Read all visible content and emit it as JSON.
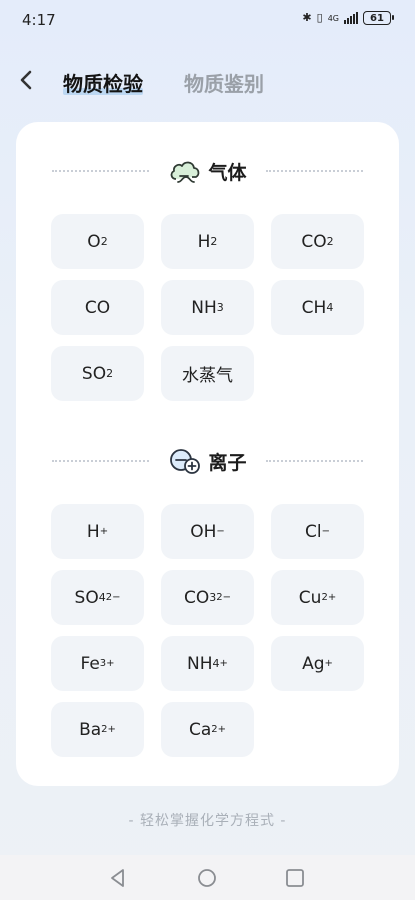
{
  "status": {
    "time": "4:17",
    "network": "4G",
    "battery": "61"
  },
  "header": {
    "back_icon": "chevron-left-icon",
    "tabs": [
      {
        "label": "物质检验",
        "active": true
      },
      {
        "label": "物质鉴别",
        "active": false
      }
    ]
  },
  "sections": [
    {
      "title": "气体",
      "icon": "cloud-icon",
      "items": [
        {
          "base": "O",
          "sub": "2",
          "sup": ""
        },
        {
          "base": "H",
          "sub": "2",
          "sup": ""
        },
        {
          "base": "CO",
          "sub": "2",
          "sup": ""
        },
        {
          "base": "CO",
          "sub": "",
          "sup": ""
        },
        {
          "base": "NH",
          "sub": "3",
          "sup": ""
        },
        {
          "base": "CH",
          "sub": "4",
          "sup": ""
        },
        {
          "base": "SO",
          "sub": "2",
          "sup": ""
        },
        {
          "base": "水蒸气",
          "sub": "",
          "sup": ""
        }
      ]
    },
    {
      "title": "离子",
      "icon": "ion-plus-minus-icon",
      "items": [
        {
          "base": "H",
          "sub": "",
          "sup": "+"
        },
        {
          "base": "OH",
          "sub": "",
          "sup": "−"
        },
        {
          "base": "Cl",
          "sub": "",
          "sup": "−"
        },
        {
          "base": "SO",
          "sub": "4",
          "sup": "2−"
        },
        {
          "base": "CO",
          "sub": "3",
          "sup": "2−"
        },
        {
          "base": "Cu",
          "sub": "",
          "sup": "2+"
        },
        {
          "base": "Fe",
          "sub": "",
          "sup": "3+"
        },
        {
          "base": "NH",
          "sub": "4",
          "sup": "+"
        },
        {
          "base": "Ag",
          "sub": "",
          "sup": "+"
        },
        {
          "base": "Ba",
          "sub": "",
          "sup": "2+"
        },
        {
          "base": "Ca",
          "sub": "",
          "sup": "2+"
        }
      ]
    }
  ],
  "footer": {
    "text": "- 轻松掌握化学方程式 -"
  },
  "colors": {
    "chip_bg": "#f1f4f8",
    "tab_highlight": "#a9cdf0",
    "icon_green": "#5aa36a",
    "icon_blue": "#3d6fb5"
  }
}
